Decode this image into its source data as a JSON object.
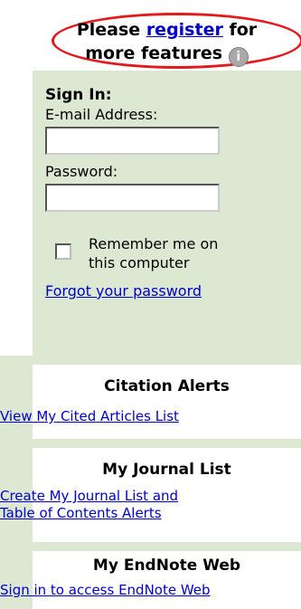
{
  "register": {
    "prefix": "Please ",
    "link": "register",
    "suffix_line1": " for",
    "line2": "more features",
    "info_glyph": "i"
  },
  "signin": {
    "title": "Sign In:",
    "email_label": "E-mail Address:",
    "email_value": "",
    "password_label": "Password:",
    "password_value": "",
    "remember_line1": "Remember me on",
    "remember_line2": "this computer",
    "remember_checked": false,
    "forgot_link": "Forgot your password"
  },
  "citation_alerts": {
    "title": "Citation Alerts",
    "link": "View My Cited Articles List"
  },
  "journal_list": {
    "title": "My Journal List",
    "link_line1": "Create My Journal List and",
    "link_line2": "Table of Contents Alerts"
  },
  "endnote": {
    "title": "My EndNote Web",
    "link": "Sign in to access EndNote Web"
  },
  "colors": {
    "panel_bg": "#dde8d2",
    "link": "#0000cc",
    "highlight_oval": "#e41a1a"
  }
}
